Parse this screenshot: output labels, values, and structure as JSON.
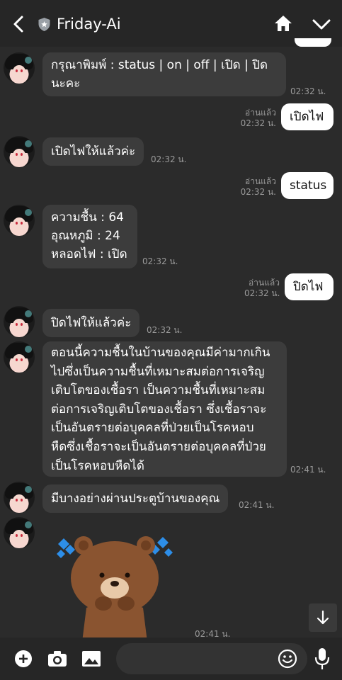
{
  "header": {
    "title": "Friday-Ai"
  },
  "messages": [
    {
      "from": "bot",
      "lines": [
        "กรุณาพิมพ์ : status | on | off | เปิด | ปิด",
        "นะคะ"
      ],
      "time": "02:32 น."
    },
    {
      "from": "me",
      "text": "เปิดไฟ",
      "read": "อ่านแล้ว",
      "time": "02:32 น."
    },
    {
      "from": "bot",
      "lines": [
        "เปิดไฟให้แล้วค่ะ"
      ],
      "time": "02:32 น."
    },
    {
      "from": "me",
      "text": "status",
      "read": "อ่านแล้ว",
      "time": "02:32 น."
    },
    {
      "from": "bot",
      "lines": [
        "ความชื้น : 64",
        "อุณหภูมิ : 24",
        "หลอดไฟ : เปิด"
      ],
      "time": "02:32 น."
    },
    {
      "from": "me",
      "text": "ปิดไฟ",
      "read": "อ่านแล้ว",
      "time": "02:32 น."
    },
    {
      "from": "bot",
      "lines": [
        "ปิดไฟให้แล้วค่ะ"
      ],
      "time": "02:32 น."
    },
    {
      "from": "bot",
      "lines": [
        "ตอนนี้ความชื้นในบ้านของคุณมีค่ามากเกิน",
        "ไปซึ่งเป็นความชื้นที่เหมาะสมต่อการเจริญ",
        "เติบโตของเชื้อรา เป็นความชื้นที่เหมาะสม",
        "ต่อการเจริญเติบโตของเชื้อรา ซึ่งเชื้อราจะ",
        "เป็นอันตรายต่อบุคคลที่ป่วยเป็นโรคหอบ",
        "หืดซึ่งเชื้อราจะเป็นอันตรายต่อบุคคลที่ป่วย",
        "เป็นโรคหอบหืดได้"
      ],
      "time": "02:41 น."
    },
    {
      "from": "bot",
      "lines": [
        "มีบางอย่างผ่านประตูบ้านของคุณ"
      ],
      "time": "02:41 น."
    },
    {
      "from": "bot",
      "sticker": "crying-bear-sticker",
      "time": "02:41 น."
    }
  ],
  "icons": {
    "back": "back-arrow-icon",
    "verified": "shield-star-icon",
    "home": "home-icon",
    "collapse": "chevron-down-icon",
    "scroll": "arrow-down-icon",
    "add": "plus-icon",
    "camera": "camera-icon",
    "gallery": "image-icon",
    "emoji": "emoji-icon",
    "mic": "microphone-icon"
  },
  "colors": {
    "background": "#2b2b2b",
    "incoming_bubble": "#3c3c3c",
    "outgoing_bubble": "#ffffff",
    "header": "#262626"
  }
}
